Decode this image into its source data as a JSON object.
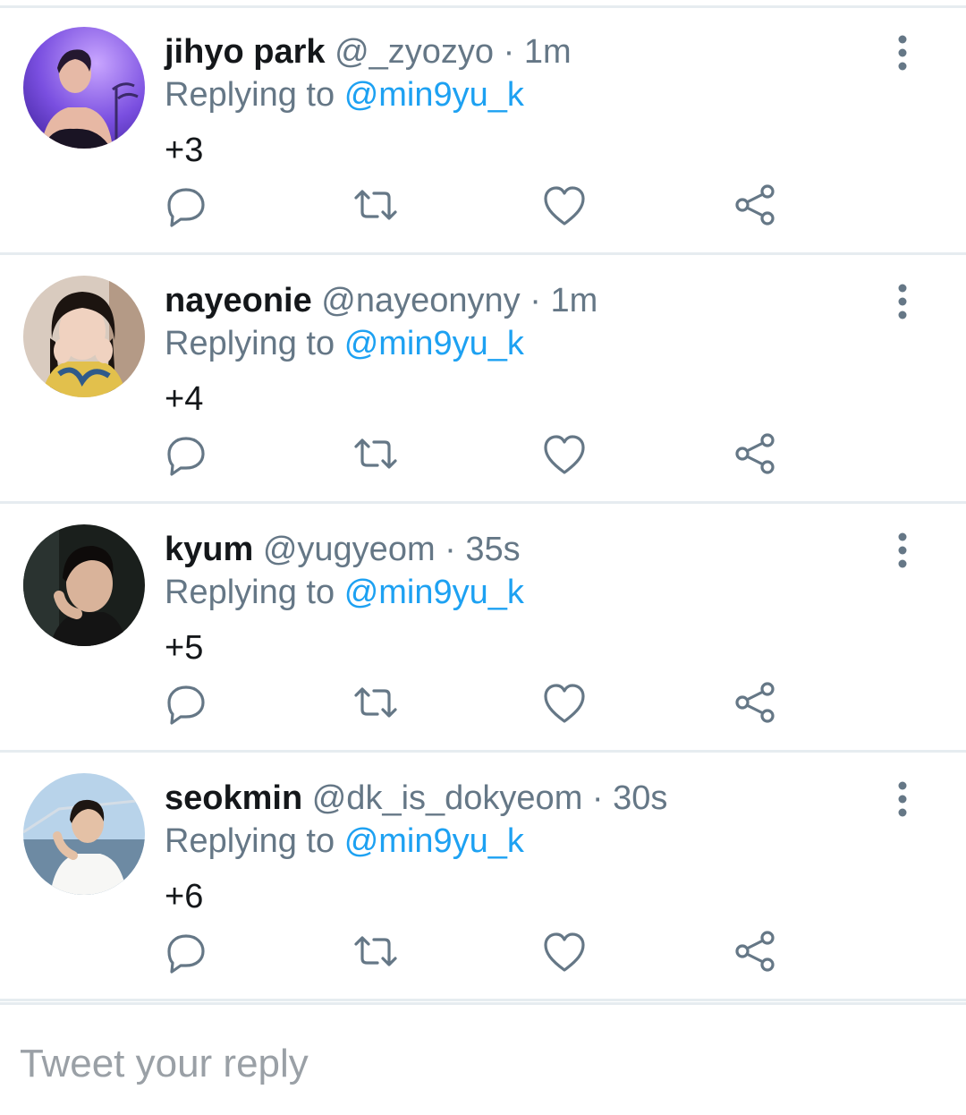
{
  "replying_prefix": "Replying to",
  "tweets": [
    {
      "name": "jihyo park",
      "handle": "@_zyozyo",
      "separator": "·",
      "time": "1m",
      "reply_to": "@min9yu_k",
      "text": "+3",
      "avatar_icon": "avatar-photo"
    },
    {
      "name": "nayeonie",
      "handle": "@nayeonyny",
      "separator": "·",
      "time": "1m",
      "reply_to": "@min9yu_k",
      "text": "+4",
      "avatar_icon": "avatar-photo"
    },
    {
      "name": "kyum",
      "handle": "@yugyeom",
      "separator": "·",
      "time": "35s",
      "reply_to": "@min9yu_k",
      "text": "+5",
      "avatar_icon": "avatar-photo"
    },
    {
      "name": "seokmin",
      "handle": "@dk_is_dokyeom",
      "separator": "·",
      "time": "30s",
      "reply_to": "@min9yu_k",
      "text": "+6",
      "avatar_icon": "avatar-photo"
    }
  ],
  "actions": [
    "reply-icon",
    "retweet-icon",
    "like-icon",
    "share-icon"
  ],
  "composer": {
    "placeholder": "Tweet your reply"
  },
  "colors": {
    "accent": "#1da1f2",
    "secondary_text": "#657786",
    "icon": "#657786",
    "divider": "#e6ecf0"
  }
}
